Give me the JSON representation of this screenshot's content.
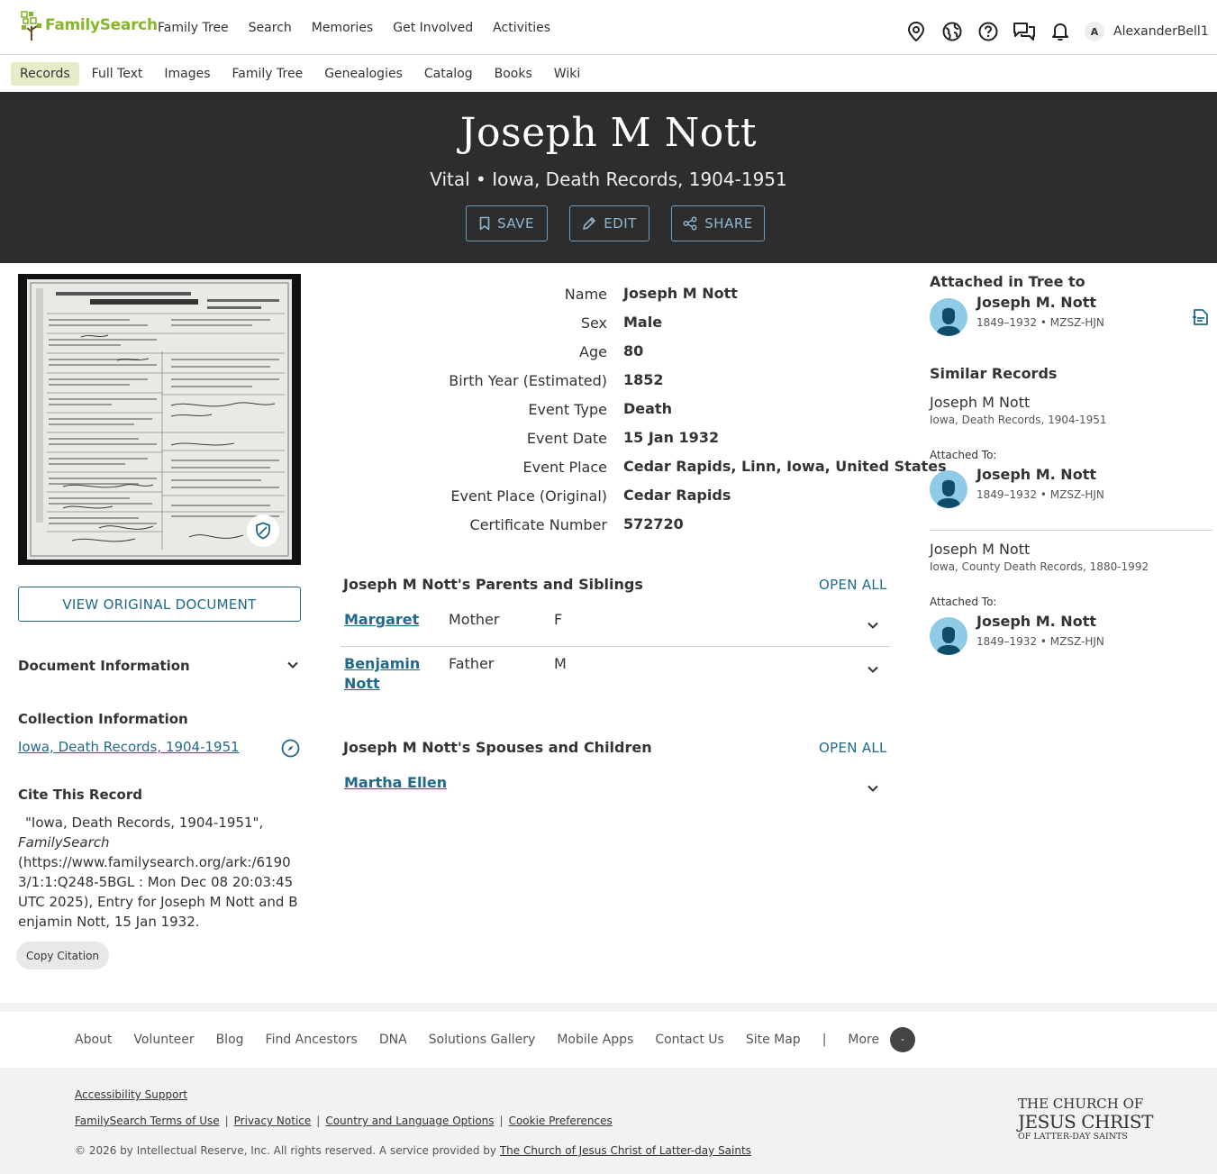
{
  "header": {
    "logo_text": "FamilySearch",
    "nav": [
      "Family Tree",
      "Search",
      "Memories",
      "Get Involved",
      "Activities"
    ],
    "user_initial": "A",
    "username": "AlexanderBell1"
  },
  "subnav": {
    "items": [
      "Records",
      "Full Text",
      "Images",
      "Family Tree",
      "Genealogies",
      "Catalog",
      "Books",
      "Wiki"
    ],
    "active": "Records"
  },
  "hero": {
    "title": "Joseph M Nott",
    "subtitle": "Vital • Iowa, Death Records, 1904-1951",
    "save_label": "SAVE",
    "edit_label": "EDIT",
    "share_label": "SHARE"
  },
  "left": {
    "view_original_label": "VIEW ORIGINAL DOCUMENT",
    "document_info_label": "Document Information",
    "collection_info_label": "Collection Information",
    "collection_link": "Iowa, Death Records, 1904-1951",
    "cite_heading": "Cite This Record",
    "cite_line1": "\"Iowa, Death Records, 1904-1951\",",
    "cite_source": "FamilySearch",
    "cite_rest": "(https://www.familysearch.org/ark:/61903/1:1:Q248-5BGL : Mon Dec 08 20:03:45 UTC 2025), Entry for Joseph M Nott and Benjamin Nott, 15 Jan 1932.",
    "copy_citation_label": "Copy Citation"
  },
  "facts": [
    {
      "label": "Name",
      "value": "Joseph M Nott"
    },
    {
      "label": "Sex",
      "value": "Male"
    },
    {
      "label": "Age",
      "value": "80"
    },
    {
      "label": "Birth Year (Estimated)",
      "value": "1852"
    },
    {
      "label": "Event Type",
      "value": "Death"
    },
    {
      "label": "Event Date",
      "value": "15 Jan 1932"
    },
    {
      "label": "Event Place",
      "value": "Cedar Rapids, Linn, Iowa, United States"
    },
    {
      "label": "Event Place (Original)",
      "value": "Cedar Rapids"
    },
    {
      "label": "Certificate Number",
      "value": "572720"
    }
  ],
  "parents": {
    "heading": "Joseph M Nott's Parents and Siblings",
    "open_all": "OPEN ALL",
    "rows": [
      {
        "name": "Margaret",
        "role": "Mother",
        "sex": "F"
      },
      {
        "name_line1": "Benjamin",
        "name_line2": "Nott",
        "role": "Father",
        "sex": "M"
      }
    ]
  },
  "spouses": {
    "heading": "Joseph M Nott's Spouses and Children",
    "open_all": "OPEN ALL",
    "rows": [
      {
        "name": "Martha Ellen"
      }
    ]
  },
  "right": {
    "attached_heading": "Attached in Tree to",
    "person_name": "Joseph M. Nott",
    "person_meta": "1849–1932 • MZSZ-HJN",
    "similar_heading": "Similar Records",
    "similar": [
      {
        "name": "Joseph M Nott",
        "collection": "Iowa, Death Records, 1904-1951",
        "attached_label": "Attached To:",
        "person_name": "Joseph M. Nott",
        "person_meta": "1849–1932 • MZSZ-HJN"
      },
      {
        "name": "Joseph M Nott",
        "collection": "Iowa, County Death Records, 1880-1992",
        "attached_label": "Attached To:",
        "person_name": "Joseph M. Nott",
        "person_meta": "1849–1932 • MZSZ-HJN"
      }
    ]
  },
  "footer": {
    "nav": [
      "About",
      "Volunteer",
      "Blog",
      "Find Ancestors",
      "DNA",
      "Solutions Gallery",
      "Mobile Apps",
      "Contact Us",
      "Site Map"
    ],
    "separator": "|",
    "more_label": "More",
    "accessibility": "Accessibility Support",
    "links": [
      "FamilySearch Terms of Use",
      "Privacy Notice",
      "Country and Language Options",
      "Cookie Preferences"
    ],
    "copyright_prefix": "© 2026 by Intellectual Reserve, Inc. All rights reserved. A service provided by",
    "copyright_link": "The Church of Jesus Christ of Latter-day Saints",
    "church_line1": "THE CHURCH OF",
    "church_line2": "JESUS CHRIST",
    "church_line3": "OF LATTER-DAY SAINTS"
  },
  "colors": {
    "brand_green": "#86b72b",
    "link_blue": "#1f6a8c",
    "hero_bg": "#2d2d2d",
    "active_tab_bg": "#e5ecc7"
  },
  "icons": [
    "tree-logo-icon",
    "location-pin-icon",
    "globe-icon",
    "help-icon",
    "chat-icon",
    "bell-icon",
    "bookmark-icon",
    "pencil-icon",
    "share-icon",
    "shield-icon",
    "chevron-down-icon",
    "compass-icon",
    "person-avatar-icon",
    "source-document-icon"
  ]
}
